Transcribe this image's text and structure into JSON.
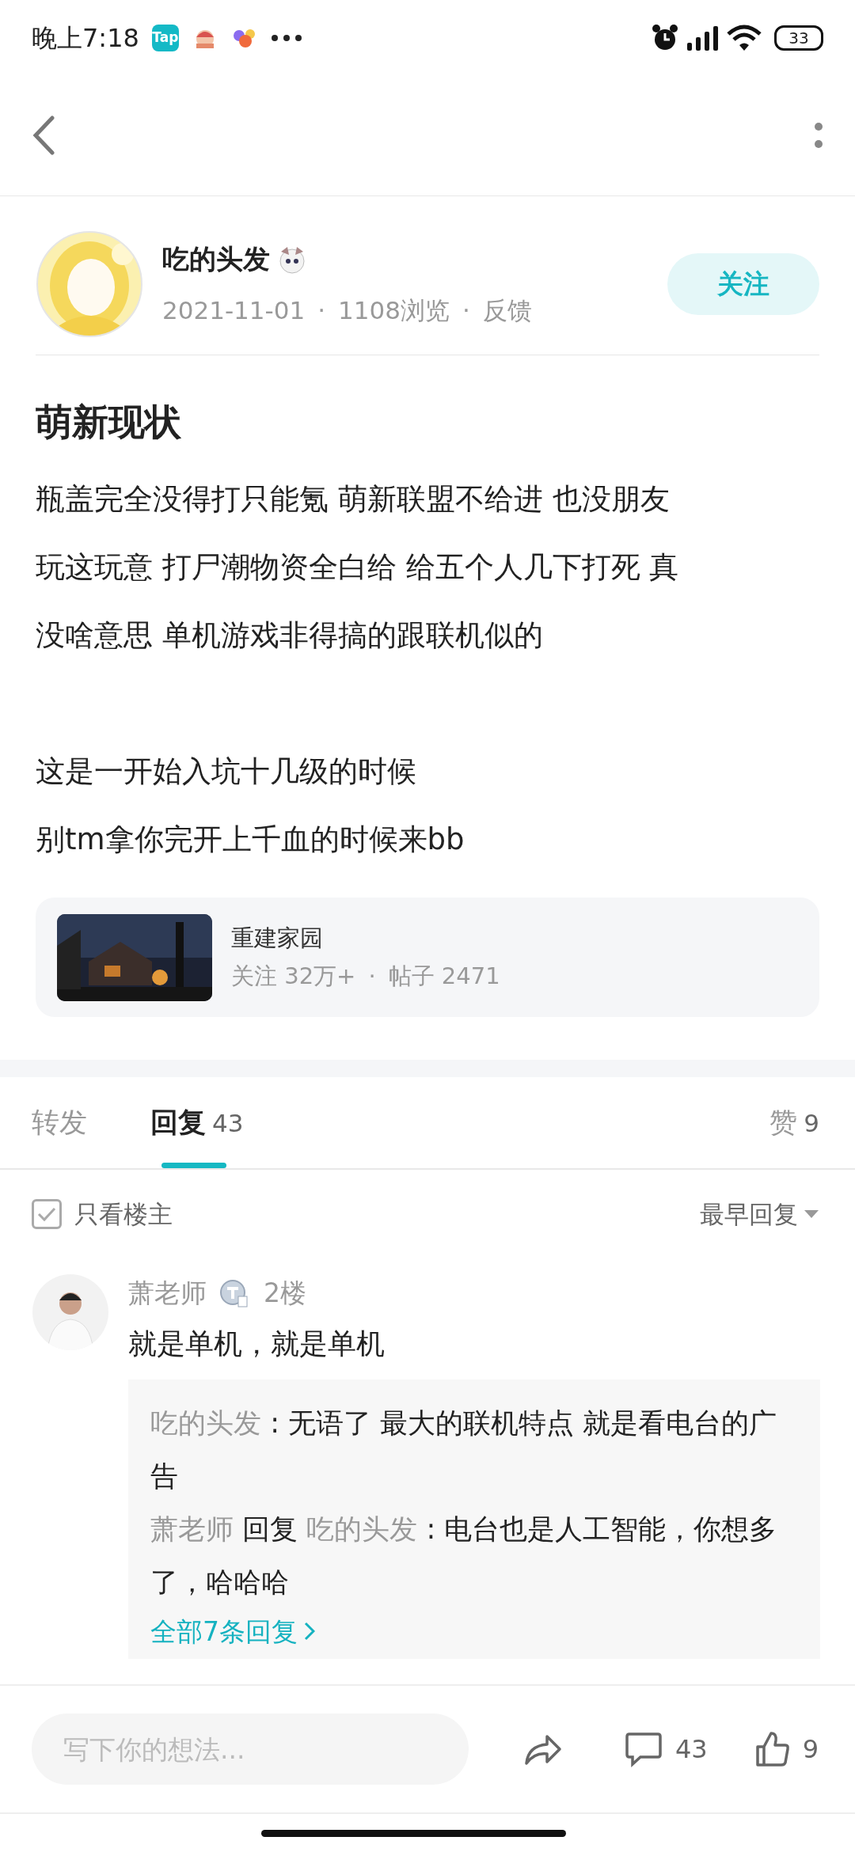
{
  "status_bar": {
    "time": "晚上7:18",
    "app_badge": "Tap",
    "battery": "33"
  },
  "author": {
    "name": "吃的头发",
    "meta": [
      "2021-11-01",
      "·",
      "1108浏览",
      "·",
      "反馈"
    ],
    "follow": "关注"
  },
  "post": {
    "title": "萌新现状",
    "paragraphs": [
      [
        "瓶盖完全没得打只能氪 萌新联盟不给进 也没朋友",
        "玩这玩意 打尸潮物资全白给 给五个人几下打死 真",
        "没啥意思 单机游戏非得搞的跟联机似的"
      ],
      [
        "这是一开始入坑十几级的时候",
        "别tm拿你完开上千血的时候来bb"
      ]
    ]
  },
  "game": {
    "name": "重建家园",
    "stats": [
      "关注 32万+",
      "·",
      "帖子 2471"
    ]
  },
  "tabs": [
    {
      "label": "转发",
      "selected": false
    },
    {
      "label": "回复",
      "count": "43",
      "selected": true
    },
    {
      "label": "赞",
      "count": "9",
      "selected": false
    }
  ],
  "filter": {
    "label": "只看楼主",
    "checked": true,
    "sort": "最早回复"
  },
  "comments": [
    {
      "name": "萧老师",
      "floor": "2楼",
      "text": "就是单机，就是单机",
      "replies": [
        {
          "author": "吃的头发",
          "text": ": 无语了 最大的联机特点 就是看电台的广告"
        },
        {
          "author": "萧老师",
          "verb": "回复",
          "target": "吃的头发",
          "text": ": 电台也是人工智能，你想多了，哈哈哈"
        }
      ],
      "more": "全部7条回复"
    }
  ],
  "bottom_bar": {
    "placeholder": "写下你的想法...",
    "comments": "43",
    "likes": "9"
  }
}
